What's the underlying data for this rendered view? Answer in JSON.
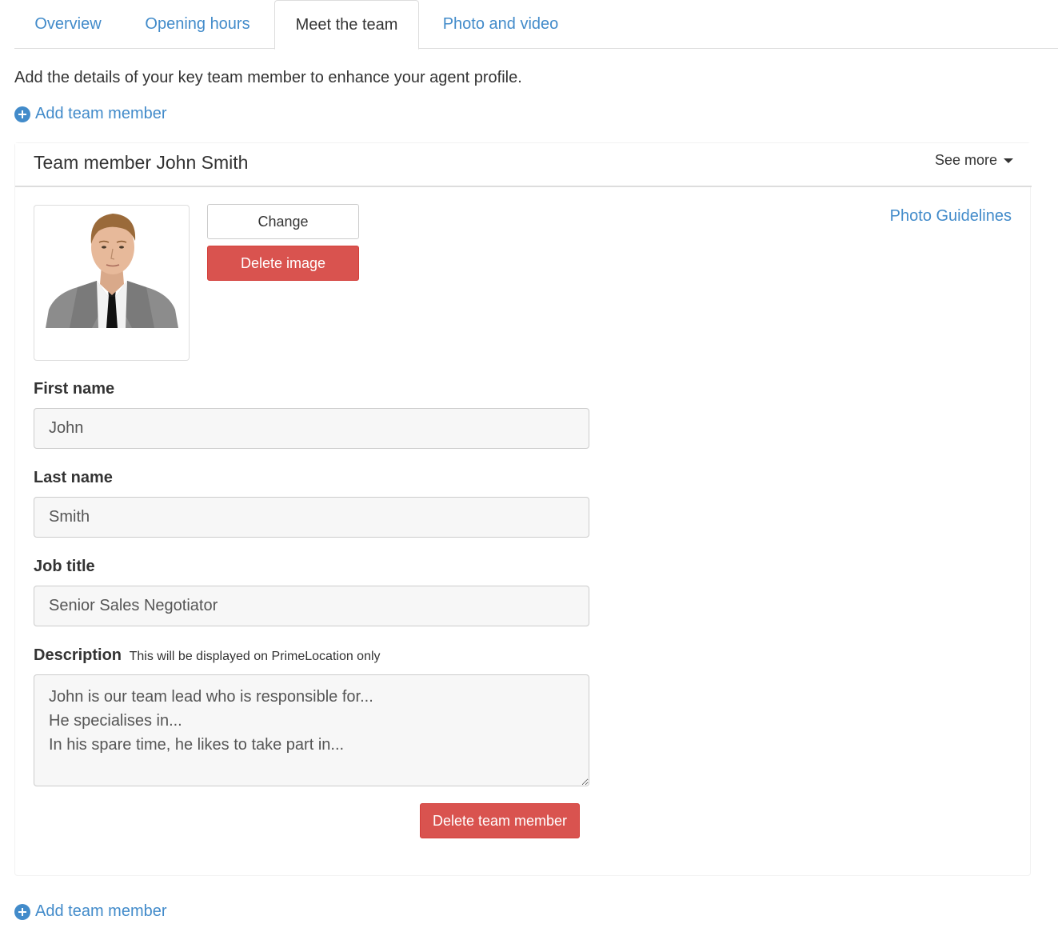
{
  "tabs": [
    {
      "label": "Overview"
    },
    {
      "label": "Opening hours"
    },
    {
      "label": "Meet the team"
    },
    {
      "label": "Photo and video"
    }
  ],
  "intro_text": "Add the details of your key team member to enhance your agent profile.",
  "add_member_label": "Add team member",
  "member": {
    "title": "Team member John Smith",
    "see_more": "See more",
    "change_button": "Change",
    "delete_image_button": "Delete image",
    "photo_guidelines": "Photo Guidelines",
    "first_name_label": "First name",
    "first_name": "John",
    "last_name_label": "Last name",
    "last_name": "Smith",
    "job_title_label": "Job title",
    "job_title": "Senior Sales Negotiator",
    "description_label": "Description",
    "description_hint": "This will be displayed on PrimeLocation only",
    "description": "John is our team lead who is responsible for...\nHe specialises in...\nIn his spare time, he likes to take part in...",
    "delete_member_button": "Delete team member"
  },
  "colors": {
    "link": "#428bca",
    "danger": "#d9534f",
    "text": "#333333"
  }
}
